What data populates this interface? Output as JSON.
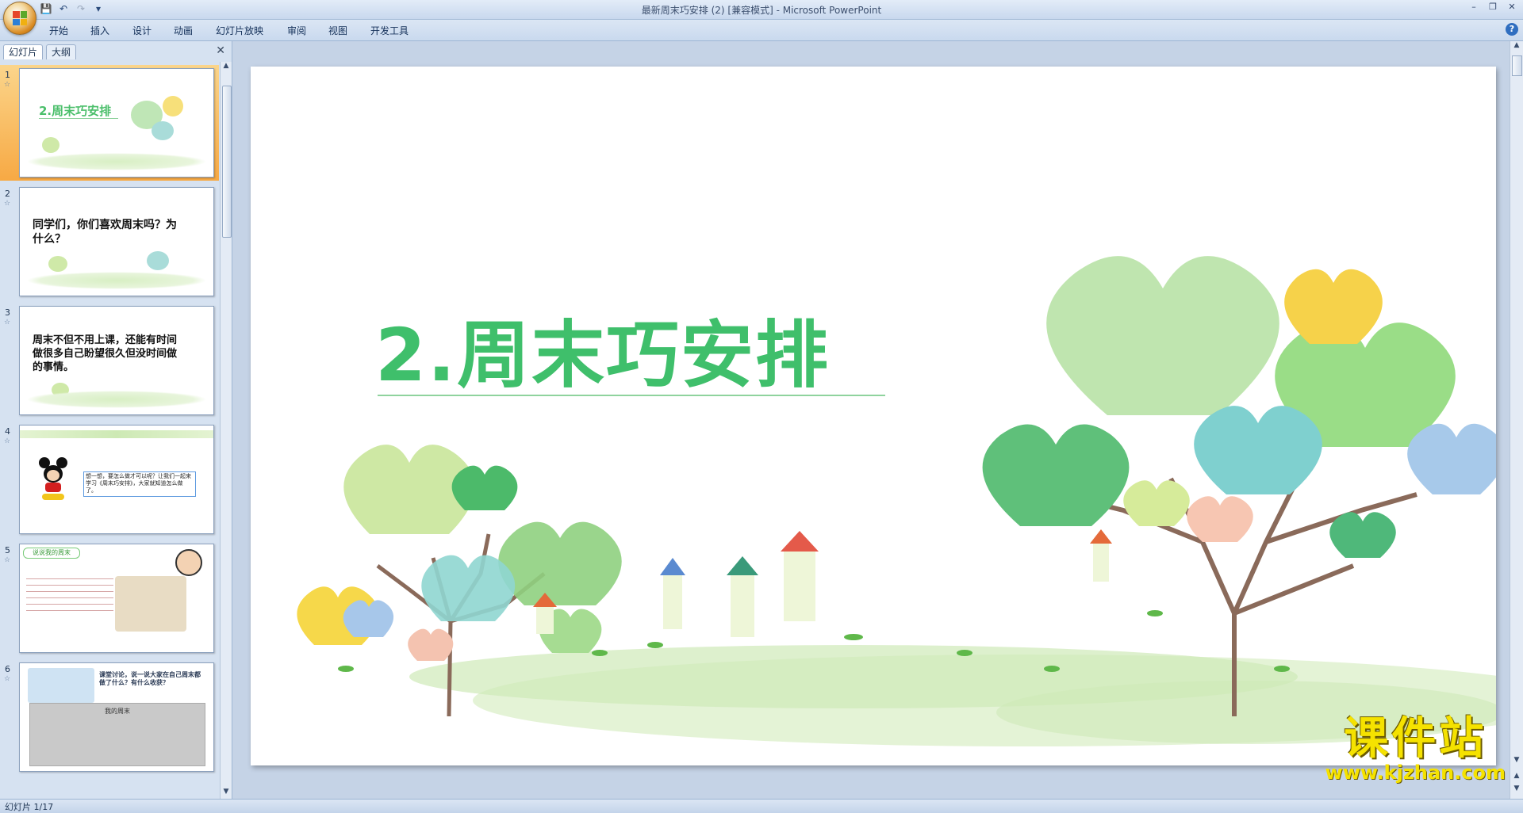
{
  "window": {
    "title": "最新周末巧安排 (2) [兼容模式] - Microsoft PowerPoint"
  },
  "quick_access": [
    "save-icon",
    "undo-icon",
    "redo-icon",
    "customize-icon"
  ],
  "ribbon": {
    "tabs": [
      "开始",
      "插入",
      "设计",
      "动画",
      "幻灯片放映",
      "审阅",
      "视图",
      "开发工具"
    ]
  },
  "left_pane": {
    "tabs": [
      "幻灯片",
      "大纲"
    ],
    "slides": [
      {
        "num": "1",
        "text": "2.周末巧安排"
      },
      {
        "num": "2",
        "text": "同学们，你们喜欢周末吗？为什么？"
      },
      {
        "num": "3",
        "text": "周末不但不用上课，还能有时间做很多自己盼望很久但没时间做的事情。"
      },
      {
        "num": "4",
        "text": "想一想，要怎么做才可以呢？让我们一起来学习《周末巧安排》，大家就知道怎么做了。"
      },
      {
        "num": "5",
        "text": "说说我的周末"
      },
      {
        "num": "6",
        "text": "课堂讨论，说一说大家在自己周末都做了什么？有什么收获？",
        "table_caption": "我的周末"
      }
    ]
  },
  "slide": {
    "title": "2.周末巧安排"
  },
  "watermark": {
    "cn": "课件站",
    "url": "www.kjzhan.com"
  },
  "status": {
    "slide_info": "幻灯片 1/17"
  }
}
